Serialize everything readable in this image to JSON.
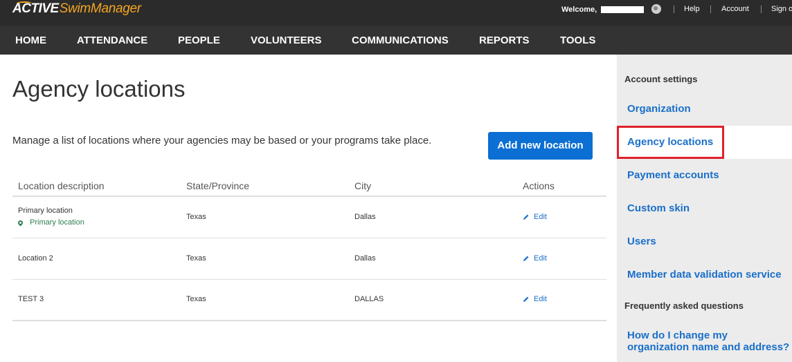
{
  "header": {
    "logo_active": "ACTIVE",
    "logo_product": "SwimManager",
    "welcome": "Welcome,",
    "links": [
      "Help",
      "Account",
      "Sign o"
    ]
  },
  "nav": {
    "items": [
      "HOME",
      "ATTENDANCE",
      "PEOPLE",
      "VOLUNTEERS",
      "COMMUNICATIONS",
      "REPORTS",
      "TOOLS"
    ]
  },
  "main": {
    "title": "Agency locations",
    "description": "Manage a list of locations where your agencies may be based or your programs take place.",
    "add_button": "Add new location",
    "table": {
      "headers": [
        "Location description",
        "State/Province",
        "City",
        "Actions"
      ],
      "rows": [
        {
          "description": "Primary location",
          "tag": "Primary location",
          "state": "Texas",
          "city": "Dallas",
          "action": "Edit"
        },
        {
          "description": "Location 2",
          "state": "Texas",
          "city": "Dallas",
          "action": "Edit"
        },
        {
          "description": "TEST 3",
          "state": "Texas",
          "city": "DALLAS",
          "action": "Edit"
        }
      ]
    }
  },
  "sidebar": {
    "heading": "Account settings",
    "items": [
      "Organization",
      "Agency locations",
      "Payment accounts",
      "Custom skin",
      "Users",
      "Member data validation service"
    ],
    "active_item": "Agency locations",
    "faq_heading": "Frequently asked questions",
    "faq_link": "How do I change my organization name and address?"
  },
  "colors": {
    "accent": "#0b6fd3",
    "link": "#1a6fc9",
    "highlight": "#e0202a",
    "primary_tag": "#2e7d4f"
  }
}
